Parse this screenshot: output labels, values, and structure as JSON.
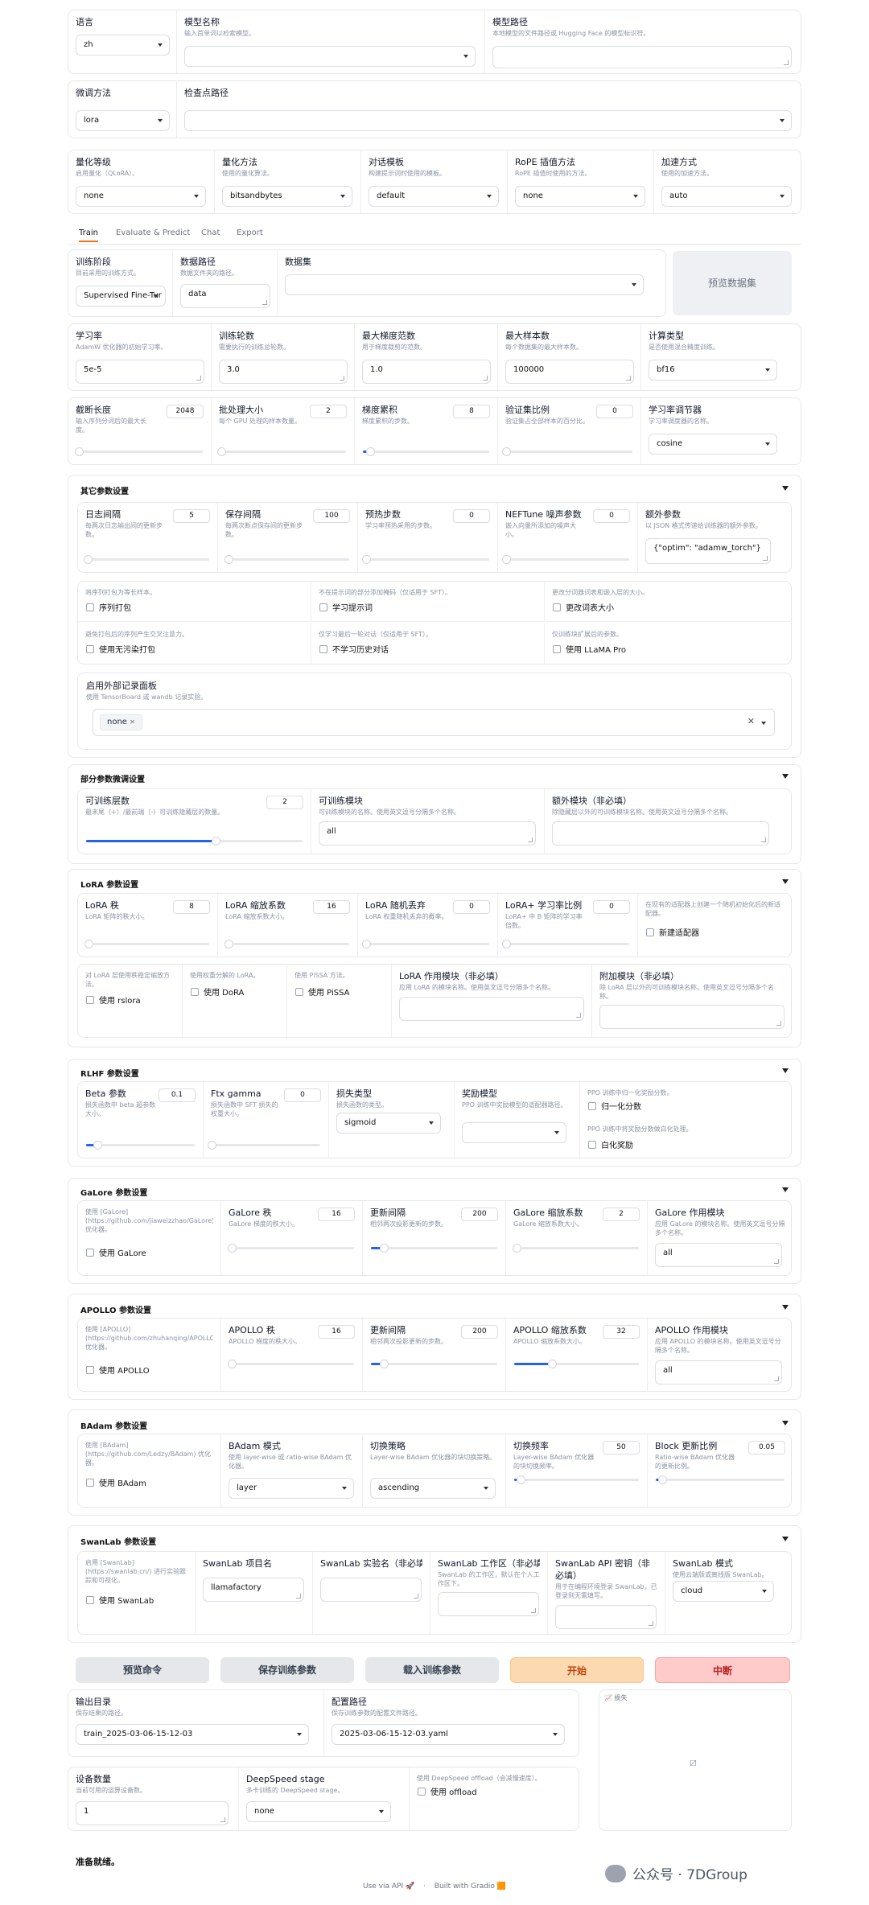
{
  "row1": {
    "lang_label": "语言",
    "lang_value": "zh",
    "model_label": "模型名称",
    "model_info": "输入首单词以检索模型。",
    "path_label": "模型路径",
    "path_info": "本地模型的文件路径或 Hugging Face 的模型标识符。"
  },
  "row2": {
    "method_label": "微调方法",
    "method_value": "lora",
    "ckpt_label": "检查点路径"
  },
  "row3": {
    "quant_label": "量化等级",
    "quant_info": "启用量化（QLoRA）。",
    "quant_value": "none",
    "qmethod_label": "量化方法",
    "qmethod_info": "使用的量化算法。",
    "qmethod_value": "bitsandbytes",
    "tpl_label": "对话模板",
    "tpl_info": "构建提示词时使用的模板。",
    "tpl_value": "default",
    "rope_label": "RoPE 插值方法",
    "rope_info": "RoPE 插值时使用的方法。",
    "rope_value": "none",
    "acc_label": "加速方式",
    "acc_info": "使用的加速方法。",
    "acc_value": "auto"
  },
  "tabs": [
    "Train",
    "Evaluate & Predict",
    "Chat",
    "Export"
  ],
  "stage": {
    "stage_label": "训练阶段",
    "stage_info": "目前采用的训练方式。",
    "stage_value": "Supervised Fine-Tur",
    "dir_label": "数据路径",
    "dir_info": "数据文件夹的路径。",
    "dir_value": "data",
    "ds_label": "数据集",
    "preview_btn": "预览数据集"
  },
  "hp": {
    "lr_label": "学习率",
    "lr_info": "AdamW 优化器的初始学习率。",
    "lr_value": "5e-5",
    "ep_label": "训练轮数",
    "ep_info": "需要执行的训练总轮数。",
    "ep_value": "3.0",
    "gn_label": "最大梯度范数",
    "gn_info": "用于梯度裁剪的范数。",
    "gn_value": "1.0",
    "ms_label": "最大样本数",
    "ms_info": "每个数据集的最大样本数。",
    "ms_value": "100000",
    "ct_label": "计算类型",
    "ct_info": "是否使用混合精度训练。",
    "ct_value": "bf16"
  },
  "hp2": {
    "cl_label": "截断长度",
    "cl_info": "输入序列分词后的最大长度。",
    "cl_value": "2048",
    "cl_frac": 0.02,
    "bs_label": "批处理大小",
    "bs_info": "每个 GPU 处理的样本数量。",
    "bs_value": "2",
    "bs_frac": 0.01,
    "ga_label": "梯度累积",
    "ga_info": "梯度累积的步数。",
    "ga_value": "8",
    "ga_frac": 0.06,
    "vs_label": "验证集比例",
    "vs_info": "验证集占全部样本的百分比。",
    "vs_value": "0",
    "vs_frac": 0,
    "sch_label": "学习率调节器",
    "sch_info": "学习率调度器的名称。",
    "sch_value": "cosine"
  },
  "other": {
    "title": "其它参数设置",
    "log_label": "日志间隔",
    "log_info": "每两次日志输出间的更新步数。",
    "log_value": "5",
    "save_label": "保存间隔",
    "save_info": "每两次断点保存间的更新步数。",
    "save_value": "100",
    "warm_label": "预热步数",
    "warm_info": "学习率预热采用的步数。",
    "warm_value": "0",
    "neft_label": "NEFTune 噪声参数",
    "neft_info": "嵌入向量所添加的噪声大小。",
    "neft_value": "0",
    "extra_label": "额外参数",
    "extra_info": "以 JSON 格式传递给训练器的额外参数。",
    "extra_value": "{\"optim\": \"adamw_torch\"}",
    "pack_info": "将序列打包为等长样本。",
    "pack_label": "序列打包",
    "tp_info": "不在提示词的部分添加掩码（仅适用于 SFT）。",
    "tp_label": "学习提示词",
    "rv_info": "更改分词器词表和嵌入层的大小。",
    "rv_label": "更改词表大小",
    "nc_info": "避免打包后的序列产生交叉注意力。",
    "nc_label": "使用无污染打包",
    "lh_info": "仅学习最后一轮对话（仅适用于 SFT）。",
    "lh_label": "不学习历史对话",
    "lp_info": "仅训练块扩展后的参数。",
    "lp_label": "使用 LLaMA Pro",
    "rep_label": "启用外部记录面板",
    "rep_info": "使用 TensorBoard 或 wandb 记录实验。",
    "rep_tag": "none"
  },
  "freeze": {
    "title": "部分参数微调设置",
    "ly_label": "可训练层数",
    "ly_info": "最末尾（+）/最前端（-）可训练隐藏层的数量。",
    "ly_value": "2",
    "ly_frac": 0.6,
    "mod_label": "可训练模块",
    "mod_info": "可训练模块的名称。使用英文逗号分隔多个名称。",
    "mod_value": "all",
    "ex_label": "额外模块（非必填）",
    "ex_info": "除隐藏层以外的可训练模块名称。使用英文逗号分隔多个名称。"
  },
  "lora": {
    "title": "LoRA 参数设置",
    "rank_label": "LoRA 秩",
    "rank_info": "LoRA 矩阵的秩大小。",
    "rank_value": "8",
    "alpha_label": "LoRA 缩放系数",
    "alpha_info": "LoRA 缩放系数大小。",
    "alpha_value": "16",
    "drop_label": "LoRA 随机丢弃",
    "drop_info": "LoRA 权重随机丢弃的概率。",
    "drop_value": "0",
    "plus_label": "LoRA+ 学习率比例",
    "plus_info": "LoRA+ 中 B 矩阵的学习率倍数。",
    "plus_value": "0",
    "new_info": "在现有的适配器上创建一个随机初始化后的新适配器。",
    "new_label": "新建适配器",
    "rs_info": "对 LoRA 层使用秩稳定缩放方法。",
    "rs_label": "使用 rslora",
    "dora_info": "使用权重分解的 LoRA。",
    "dora_label": "使用 DoRA",
    "pissa_info": "使用 PiSSA 方法。",
    "pissa_label": "使用 PiSSA",
    "tgt_label": "LoRA 作用模块（非必填）",
    "tgt_info": "应用 LoRA 的模块名称。使用英文逗号分隔多个名称。",
    "add_label": "附加模块（非必填）",
    "add_info": "除 LoRA 层以外的可训练模块名称。使用英文逗号分隔多个名称。"
  },
  "rlhf": {
    "title": "RLHF 参数设置",
    "beta_label": "Beta 参数",
    "beta_info": "损失函数中 beta 超参数大小。",
    "beta_value": "0.1",
    "beta_frac": 0.1,
    "ftx_label": "Ftx gamma",
    "ftx_info": "损失函数中 SFT 损失的权重大小。",
    "ftx_value": "0",
    "ftx_frac": 0,
    "loss_label": "损失类型",
    "loss_info": "损失函数的类型。",
    "loss_value": "sigmoid",
    "rm_label": "奖励模型",
    "rm_info": "PPO 训练中奖励模型的适配器路径。",
    "norm_info": "PPO 训练中归一化奖励分数。",
    "norm_label": "归一化分数",
    "white_info": "PPO 训练中将奖励分数做白化处理。",
    "white_label": "白化奖励"
  },
  "galore": {
    "title": "GaLore 参数设置",
    "use_info": "使用 [GaLore] (https://github.com/jiaweizzhao/GaLore) 优化器。",
    "use_label": "使用 GaLore",
    "rank_label": "GaLore 秩",
    "rank_info": "GaLore 梯度的秩大小。",
    "rank_value": "16",
    "rank_frac": 0.02,
    "upd_label": "更新间隔",
    "upd_info": "相邻两次投影更新的步数。",
    "upd_value": "200",
    "upd_frac": 0.1,
    "scale_label": "GaLore 缩放系数",
    "scale_info": "GaLore 缩放系数大小。",
    "scale_value": "2",
    "scale_frac": 0.02,
    "tgt_label": "GaLore 作用模块",
    "tgt_info": "应用 GaLore 的模块名称。使用英文逗号分隔多个名称。",
    "tgt_value": "all"
  },
  "apollo": {
    "title": "APOLLO 参数设置",
    "use_info": "使用 [APOLLO] (https://github.com/zhuhanqing/APOLLO) 优化器。",
    "use_label": "使用 APOLLO",
    "rank_label": "APOLLO 秩",
    "rank_info": "APOLLO 梯度的秩大小。",
    "rank_value": "16",
    "rank_frac": 0.02,
    "upd_label": "更新间隔",
    "upd_info": "相邻两次投影更新的步数。",
    "upd_value": "200",
    "upd_frac": 0.1,
    "scale_label": "APOLLO 缩放系数",
    "scale_info": "APOLLO 缩放系数大小。",
    "scale_value": "32",
    "scale_frac": 0.3,
    "tgt_label": "APOLLO 作用模块",
    "tgt_info": "应用 APOLLO 的模块名称。使用英文逗号分隔多个名称。",
    "tgt_value": "all"
  },
  "badam": {
    "title": "BAdam 参数设置",
    "use_info": "使用 [BAdam] (https://github.com/Ledzy/BAdam) 优化器。",
    "use_label": "使用 BAdam",
    "mode_label": "BAdam 模式",
    "mode_info": "使用 layer-wise 或 ratio-wise BAdam 优化器。",
    "mode_value": "layer",
    "sw_label": "切换策略",
    "sw_info": "Layer-wise BAdam 优化器的块切换策略。",
    "sw_value": "ascending",
    "freq_label": "切换频率",
    "freq_info": "Layer-wise BAdam 优化器的块切换频率。",
    "freq_value": "50",
    "freq_frac": 0.05,
    "ur_label": "Block 更新比例",
    "ur_info": "Ratio-wise BAdam 优化器的更新比例。",
    "ur_value": "0.05",
    "ur_frac": 0.05
  },
  "swan": {
    "title": "SwanLab 参数设置",
    "use_info": "启用 [SwanLab] (https://swanlab.cn/) 进行实验跟踪和可视化。",
    "use_label": "使用 SwanLab",
    "proj_label": "SwanLab 项目名",
    "proj_value": "llamafactory",
    "run_label": "SwanLab 实验名（非必填）",
    "ws_label": "SwanLab 工作区（非必填）",
    "ws_info": "SwanLab 的工作区，默认在个人工作区下。",
    "api_label": "SwanLab API 密钥（非必填）",
    "api_info": "用于在编程环境登录 SwanLab，已登录则无需填写。",
    "mode_label": "SwanLab 模式",
    "mode_info": "使用云端版或离线版 SwanLab。",
    "mode_value": "cloud"
  },
  "buttons": {
    "preview": "预览命令",
    "save": "保存训练参数",
    "load": "载入训练参数",
    "start": "开始",
    "abort": "中断"
  },
  "out": {
    "od_label": "输出目录",
    "od_info": "保存结果的路径。",
    "od_value": "train_2025-03-06-15-12-03",
    "cfg_label": "配置路径",
    "cfg_info": "保存训练参数的配置文件路径。",
    "cfg_value": "2025-03-06-15-12-03.yaml",
    "loss_label": "损失",
    "dev_label": "设备数量",
    "dev_info": "当前可用的运算设备数。",
    "dev_value": "1",
    "ds_label": "DeepSpeed stage",
    "ds_info": "多卡训练的 DeepSpeed stage。",
    "ds_value": "none",
    "off_info": "使用 DeepSpeed offload（会减慢速度）。",
    "off_label": "使用 offload"
  },
  "status": "准备就绪。",
  "footer": {
    "api": "Use via API",
    "built": "Built with Gradio"
  },
  "watermark": "公众号 · 7DGroup",
  "colors": {
    "accent": "#f97316",
    "slider": "#2563eb",
    "start_bg": "#fcd9b0",
    "abort_bg": "#fecaca"
  }
}
